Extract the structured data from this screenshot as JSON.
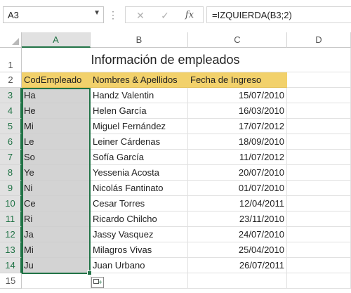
{
  "formula_bar": {
    "name_box": "A3",
    "formula": "=IZQUIERDA(B3;2)",
    "insert_function_icon": "fx"
  },
  "columns": [
    "A",
    "B",
    "C",
    "D"
  ],
  "selected_column": "A",
  "rows": [
    "1",
    "2",
    "3",
    "4",
    "5",
    "6",
    "7",
    "8",
    "9",
    "10",
    "11",
    "12",
    "13",
    "14",
    "15"
  ],
  "title": "Información de empleados",
  "headers": {
    "code": "CodEmpleado",
    "name": "Nombres & Apellidos",
    "date": "Fecha de Ingreso"
  },
  "employees": [
    {
      "code": "Ha",
      "name": "Handz Valentin",
      "date": "15/07/2010"
    },
    {
      "code": "He",
      "name": "Helen García",
      "date": "16/03/2010"
    },
    {
      "code": "Mi",
      "name": "Miguel Fernández",
      "date": "17/07/2012"
    },
    {
      "code": "Le",
      "name": "Leiner Cárdenas",
      "date": "18/09/2010"
    },
    {
      "code": "So",
      "name": "Sofía García",
      "date": "11/07/2012"
    },
    {
      "code": "Ye",
      "name": "Yessenia Acosta",
      "date": "20/07/2010"
    },
    {
      "code": "Ni",
      "name": "Nicolás Fantinato",
      "date": "01/07/2010"
    },
    {
      "code": "Ce",
      "name": "Cesar Torres",
      "date": "12/04/2011"
    },
    {
      "code": "Ri",
      "name": "Ricardo Chilcho",
      "date": "23/11/2010"
    },
    {
      "code": "Ja",
      "name": "Jassy Vasquez",
      "date": "24/07/2010"
    },
    {
      "code": "Mi",
      "name": "Milagros Vivas",
      "date": "25/04/2010"
    },
    {
      "code": "Ju",
      "name": "Juan Urbano",
      "date": "26/07/2011"
    }
  ],
  "colors": {
    "header_fill": "#f2d16b",
    "selection_fill": "#d3d3d3",
    "selection_border": "#217346"
  }
}
